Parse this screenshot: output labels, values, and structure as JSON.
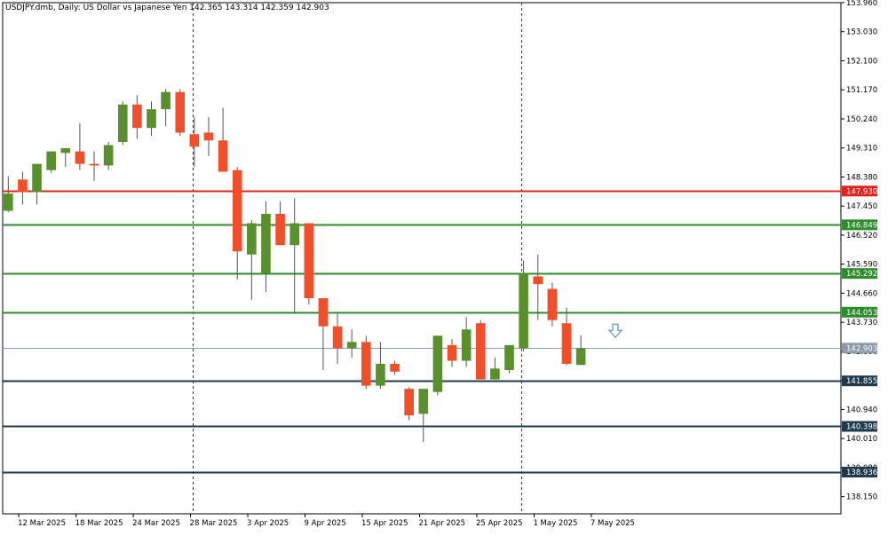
{
  "chart_title": "USDJPY.dmb, Daily:  US Dollar vs Japanese Yen  142.365 143.314 142.359 142.903",
  "chart_data": {
    "type": "candlestick",
    "symbol": "USDJPY.dmb",
    "timeframe": "Daily",
    "description": "US Dollar vs Japanese Yen",
    "last_ohlc": {
      "open": 142.365,
      "high": 143.314,
      "low": 142.359,
      "close": 142.903
    },
    "y_range": [
      137.6,
      153.96
    ],
    "y_ticks": [
      "153.960",
      "153.030",
      "152.100",
      "151.170",
      "150.240",
      "149.310",
      "148.380",
      "147.450",
      "146.520",
      "145.590",
      "144.660",
      "143.730",
      "142.800",
      "141.870",
      "140.940",
      "140.010",
      "139.080",
      "138.150"
    ],
    "x_ticks": [
      "12 Mar 2025",
      "18 Mar 2025",
      "24 Mar 2025",
      "28 Mar 2025",
      "3 Apr 2025",
      "9 Apr 2025",
      "15 Apr 2025",
      "21 Apr 2025",
      "25 Apr 2025",
      "1 May 2025",
      "7 May 2025"
    ],
    "candles": [
      {
        "date": "2025-03-11",
        "o": 147.3,
        "h": 148.4,
        "l": 147.25,
        "c": 147.85
      },
      {
        "date": "2025-03-12",
        "o": 148.3,
        "h": 148.55,
        "l": 147.5,
        "c": 147.9
      },
      {
        "date": "2025-03-13",
        "o": 147.9,
        "h": 148.8,
        "l": 147.5,
        "c": 148.8
      },
      {
        "date": "2025-03-14",
        "o": 148.6,
        "h": 149.2,
        "l": 148.5,
        "c": 149.2
      },
      {
        "date": "2025-03-17",
        "o": 149.15,
        "h": 149.3,
        "l": 148.7,
        "c": 149.3
      },
      {
        "date": "2025-03-18",
        "o": 149.2,
        "h": 150.1,
        "l": 148.6,
        "c": 148.8
      },
      {
        "date": "2025-03-19",
        "o": 148.8,
        "h": 149.2,
        "l": 148.25,
        "c": 148.75
      },
      {
        "date": "2025-03-20",
        "o": 148.75,
        "h": 149.5,
        "l": 148.6,
        "c": 149.4
      },
      {
        "date": "2025-03-21",
        "o": 149.5,
        "h": 150.8,
        "l": 149.4,
        "c": 150.7
      },
      {
        "date": "2025-03-24",
        "o": 150.7,
        "h": 151.0,
        "l": 149.6,
        "c": 149.95
      },
      {
        "date": "2025-03-25",
        "o": 149.95,
        "h": 150.8,
        "l": 149.7,
        "c": 150.55
      },
      {
        "date": "2025-03-26",
        "o": 150.55,
        "h": 151.2,
        "l": 150.0,
        "c": 151.1
      },
      {
        "date": "2025-03-27",
        "o": 151.1,
        "h": 151.2,
        "l": 149.7,
        "c": 149.8
      },
      {
        "date": "2025-03-28",
        "o": 149.75,
        "h": 150.3,
        "l": 148.7,
        "c": 149.35
      },
      {
        "date": "2025-03-31",
        "o": 149.8,
        "h": 150.3,
        "l": 149.05,
        "c": 149.55
      },
      {
        "date": "2025-04-01",
        "o": 149.55,
        "h": 150.6,
        "l": 148.6,
        "c": 148.55
      },
      {
        "date": "2025-04-02",
        "o": 148.6,
        "h": 148.7,
        "l": 145.1,
        "c": 146.0
      },
      {
        "date": "2025-04-03",
        "o": 145.9,
        "h": 147.0,
        "l": 144.45,
        "c": 146.9
      },
      {
        "date": "2025-04-04",
        "o": 145.3,
        "h": 147.6,
        "l": 144.7,
        "c": 147.2
      },
      {
        "date": "2025-04-07",
        "o": 147.2,
        "h": 147.6,
        "l": 146.2,
        "c": 146.2
      },
      {
        "date": "2025-04-08",
        "o": 146.2,
        "h": 147.7,
        "l": 144.0,
        "c": 146.9
      },
      {
        "date": "2025-04-09",
        "o": 146.9,
        "h": 146.9,
        "l": 144.3,
        "c": 144.5
      },
      {
        "date": "2025-04-10",
        "o": 144.5,
        "h": 144.5,
        "l": 142.2,
        "c": 143.6
      },
      {
        "date": "2025-04-11",
        "o": 143.6,
        "h": 144.0,
        "l": 142.4,
        "c": 142.9
      },
      {
        "date": "2025-04-14",
        "o": 142.9,
        "h": 143.5,
        "l": 142.6,
        "c": 143.1
      },
      {
        "date": "2025-04-15",
        "o": 143.1,
        "h": 143.3,
        "l": 141.6,
        "c": 141.7
      },
      {
        "date": "2025-04-16",
        "o": 141.7,
        "h": 143.1,
        "l": 141.6,
        "c": 142.4
      },
      {
        "date": "2025-04-17",
        "o": 142.4,
        "h": 142.5,
        "l": 142.05,
        "c": 142.15
      },
      {
        "date": "2025-04-18",
        "o": 141.6,
        "h": 141.65,
        "l": 140.6,
        "c": 140.75
      },
      {
        "date": "2025-04-21",
        "o": 140.8,
        "h": 141.6,
        "l": 139.9,
        "c": 141.6
      },
      {
        "date": "2025-04-22",
        "o": 141.5,
        "h": 143.3,
        "l": 141.4,
        "c": 143.3
      },
      {
        "date": "2025-04-23",
        "o": 143.0,
        "h": 143.2,
        "l": 142.3,
        "c": 142.5
      },
      {
        "date": "2025-04-24",
        "o": 142.5,
        "h": 143.9,
        "l": 142.3,
        "c": 143.5
      },
      {
        "date": "2025-04-25",
        "o": 143.7,
        "h": 143.8,
        "l": 141.9,
        "c": 141.9
      },
      {
        "date": "2025-04-28",
        "o": 141.9,
        "h": 142.6,
        "l": 141.9,
        "c": 142.25
      },
      {
        "date": "2025-04-29",
        "o": 142.2,
        "h": 143.0,
        "l": 142.1,
        "c": 143.0
      },
      {
        "date": "2025-04-30",
        "o": 142.9,
        "h": 145.7,
        "l": 142.8,
        "c": 145.3
      },
      {
        "date": "2025-05-01",
        "o": 145.2,
        "h": 145.9,
        "l": 143.8,
        "c": 144.95
      },
      {
        "date": "2025-05-02",
        "o": 144.8,
        "h": 145.0,
        "l": 143.6,
        "c": 143.8
      },
      {
        "date": "2025-05-05",
        "o": 143.7,
        "h": 144.2,
        "l": 142.35,
        "c": 142.4
      },
      {
        "date": "2025-05-06",
        "o": 142.365,
        "h": 143.314,
        "l": 142.359,
        "c": 142.903
      }
    ],
    "horizontal_levels": [
      {
        "label": "147.930",
        "value": 147.93,
        "color": "#e0231b",
        "text_color": "#ffffff"
      },
      {
        "label": "146.849",
        "value": 146.849,
        "color": "#2e8b2e",
        "text_color": "#ffffff"
      },
      {
        "label": "145.292",
        "value": 145.292,
        "color": "#2e8b2e",
        "text_color": "#ffffff"
      },
      {
        "label": "144.053",
        "value": 144.053,
        "color": "#2e8b2e",
        "text_color": "#ffffff"
      },
      {
        "label": "142.903",
        "value": 142.903,
        "color": "#8c9aa9",
        "text_color": "#ffffff"
      },
      {
        "label": "141.855",
        "value": 141.855,
        "color": "#1f3a4d",
        "text_color": "#ffffff"
      },
      {
        "label": "140.398",
        "value": 140.398,
        "color": "#1f3a4d",
        "text_color": "#ffffff"
      },
      {
        "label": "138.936",
        "value": 138.936,
        "color": "#1f3a4d",
        "text_color": "#ffffff"
      }
    ],
    "vertical_markers": [
      "2025-03-28",
      "2025-04-30"
    ],
    "arrow": {
      "type": "down",
      "date": "2025-05-08",
      "value": 143.5
    },
    "colors": {
      "bull": "#5a8f2e",
      "bear": "#f04f2a",
      "wick": "#555555",
      "frame": "#000000",
      "grid_text": "#000000"
    }
  }
}
